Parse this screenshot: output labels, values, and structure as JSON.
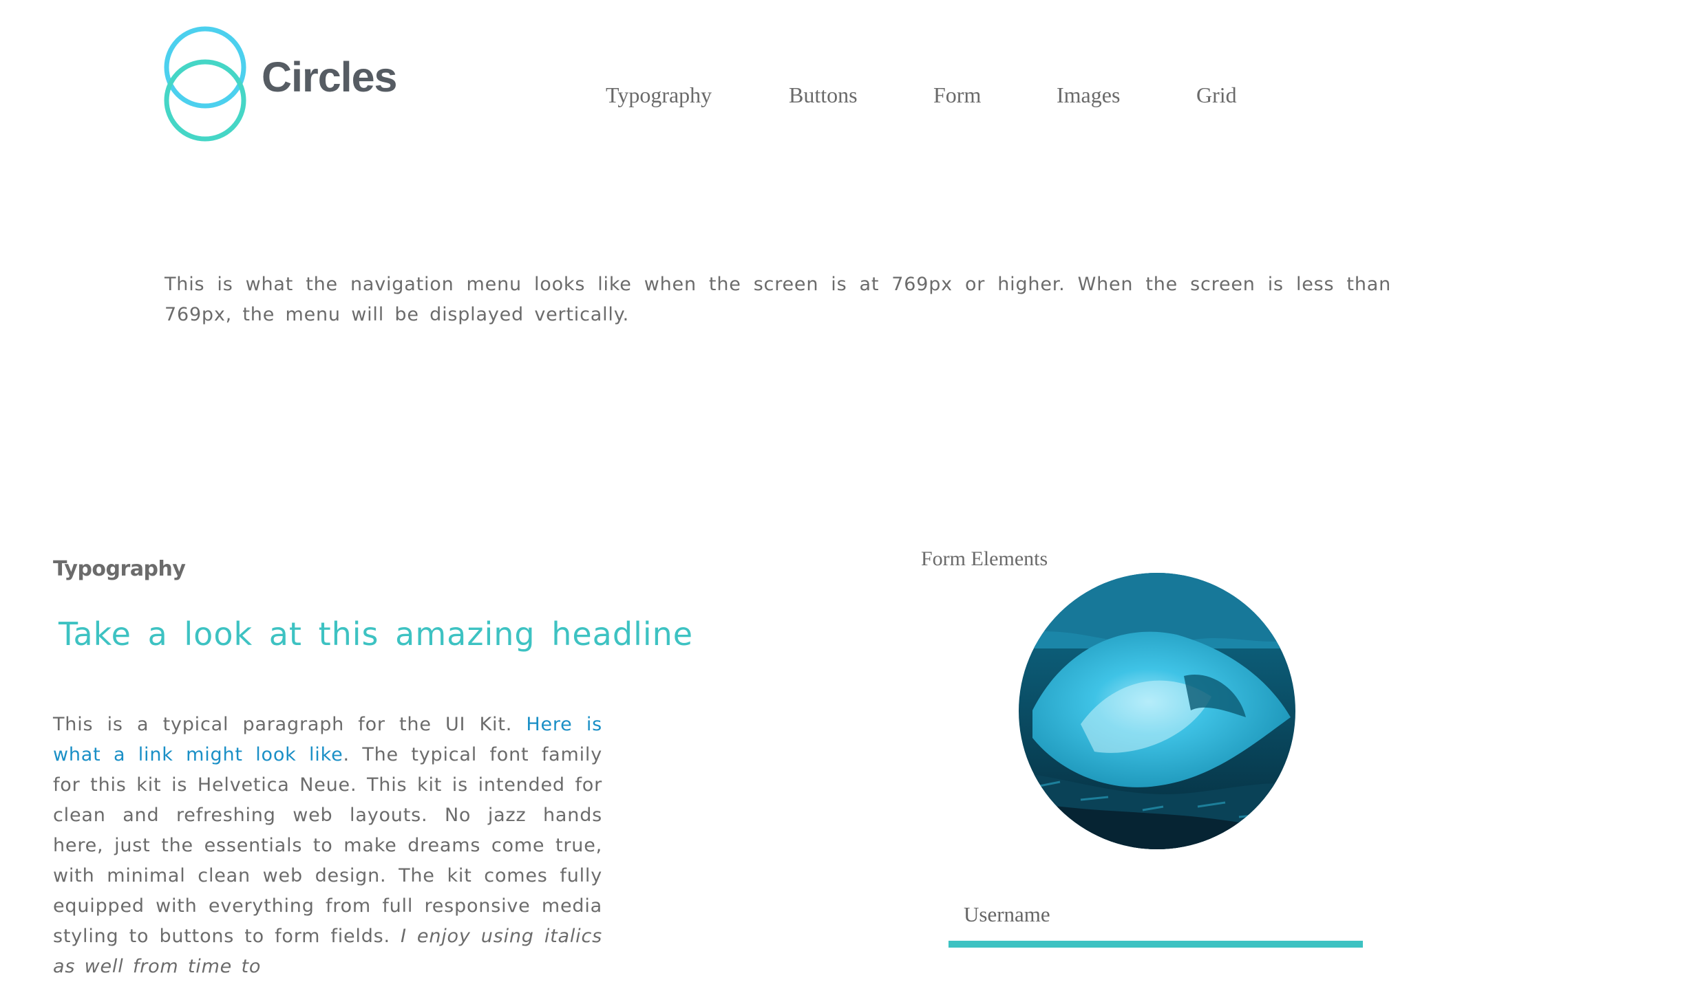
{
  "brand": {
    "name": "Circles",
    "logo_colors": [
      "#4cd0ee",
      "#45d6c6"
    ]
  },
  "nav": {
    "items": [
      {
        "label": "Typography"
      },
      {
        "label": "Buttons"
      },
      {
        "label": "Form"
      },
      {
        "label": "Images"
      },
      {
        "label": "Grid"
      }
    ]
  },
  "intro": "This is what the navigation menu looks like when the screen is at 769px or higher. When the screen is less than 769px, the menu will be displayed vertically.",
  "typography": {
    "section_title": "Typography",
    "headline": "Take a look at this amazing headline",
    "paragraph_start": "This is a typical paragraph for the UI Kit. ",
    "link_text": "Here is what a link might look like",
    "paragraph_mid": ". The typical font family for this kit is Helvetica Neue. This kit is intended for clean and refreshing web layouts. No jazz hands here, just the essentials to make dreams come true, with minimal clean web design. The kit comes fully equipped with everything from full responsive media styling to buttons to form fields. ",
    "italic_text": "I enjoy using italics as well from time to"
  },
  "form": {
    "section_title": "Form Elements",
    "image_icon": "ocean-wave-photo",
    "username_label": "Username",
    "username_value": ""
  },
  "colors": {
    "accent": "#3dc2c2",
    "link": "#1a8fc6",
    "text": "#6b6b6b"
  }
}
